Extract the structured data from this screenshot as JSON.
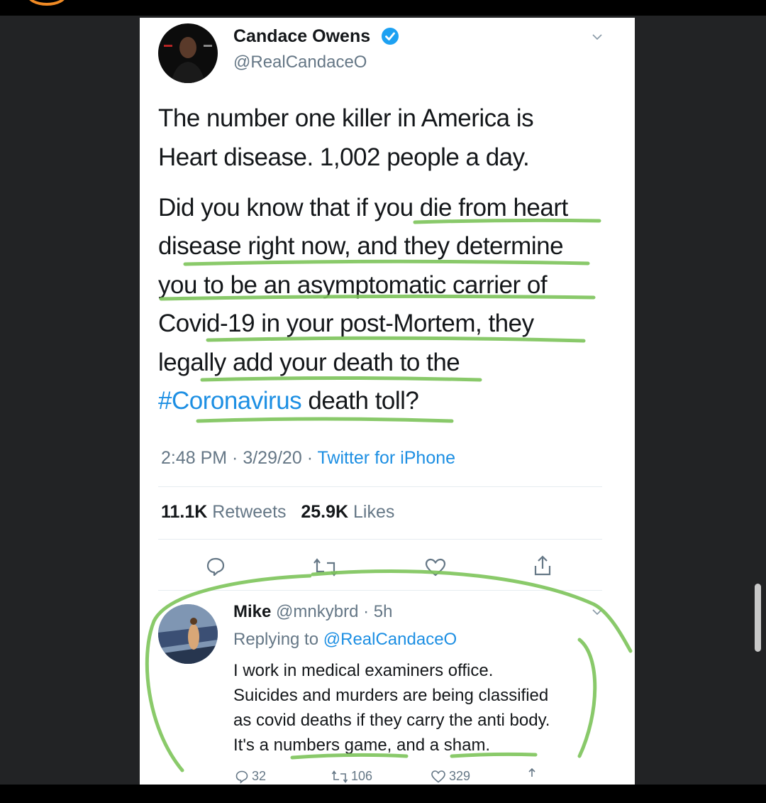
{
  "tweet": {
    "author_name": "Candace Owens",
    "author_handle": "@RealCandaceO",
    "text_lines": [
      "The number one killer in America is",
      "Heart disease. 1,002 people a day.",
      "Did you know that if you die from heart",
      "disease right now, and they determine",
      "you to be an asymptomatic carrier of",
      "Covid-19 in your post-Mortem, they",
      "legally add your death to the"
    ],
    "hashtag": "#Coronavirus",
    "text_end": " death toll?",
    "time": "2:48 PM",
    "date": "3/29/20",
    "source": "Twitter for iPhone",
    "retweets_count": "11.1K",
    "retweets_label": "Retweets",
    "likes_count": "25.9K",
    "likes_label": "Likes",
    "icons": [
      "reply-icon",
      "retweet-icon",
      "like-icon",
      "share-icon",
      "verified-icon",
      "chevron-down-icon"
    ]
  },
  "reply": {
    "author_name": "Mike",
    "author_handle": "@mnkybrd",
    "age": "5h",
    "replying_label": "Replying to",
    "replying_handle": "@RealCandaceO",
    "text_lines": [
      "I work in medical examiners office.",
      "Suicides and murders are being classified",
      "as covid deaths if they carry the anti body.",
      "It's a numbers game, and a sham."
    ],
    "reply_count": "32",
    "retweet_count": "106",
    "like_count": "329"
  },
  "colors": {
    "background": "#222325",
    "card": "#ffffff",
    "link": "#1d8fe3",
    "annotation": "#7dc45a",
    "verified": "#1da1f2"
  }
}
